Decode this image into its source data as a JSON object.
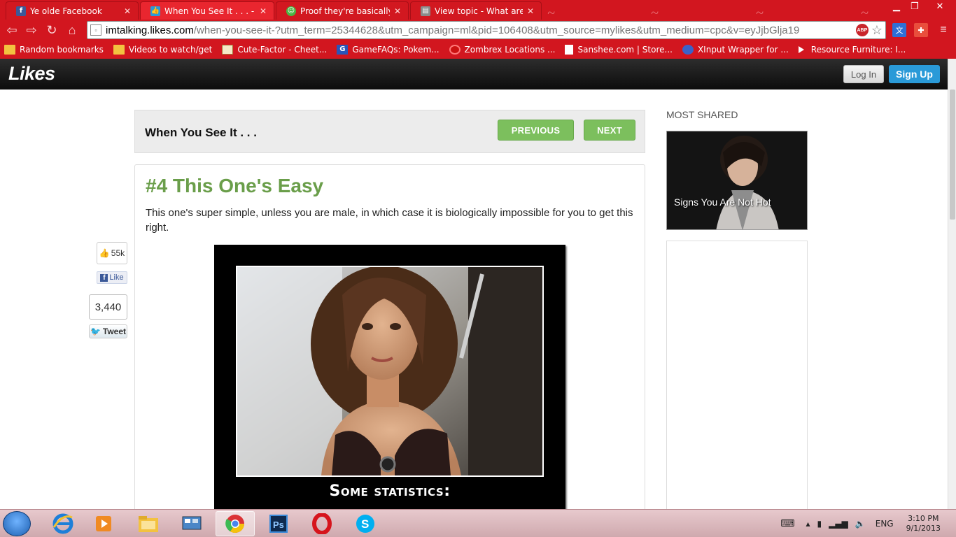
{
  "browser": {
    "tabs": [
      {
        "label": "Ye olde Facebook",
        "icon": "facebook-icon",
        "color": "#3b5998"
      },
      {
        "label": "When You See It . . . - Like",
        "icon": "likes-thumb-icon",
        "color": "#2a9ad8"
      },
      {
        "label": "Proof they're basically the",
        "icon": "smiley-icon",
        "color": "#4bb543"
      },
      {
        "label": "View topic - What are you",
        "icon": "forum-icon",
        "color": "#777"
      }
    ],
    "url_host": "imtalking.likes.com",
    "url_path": "/when-you-see-it-?utm_term=25344628&utm_campaign=ml&pid=106408&utm_source=mylikes&utm_medium=cpc&v=eyJjbGlja19",
    "abp_label": "ABP",
    "bookmarks": [
      {
        "label": "Random bookmarks",
        "icon": "folder-icon"
      },
      {
        "label": "Videos to watch/get",
        "icon": "folder-icon"
      },
      {
        "label": "Cute-Factor - Cheet...",
        "icon": "cheetah-icon"
      },
      {
        "label": "GameFAQs: Pokem...",
        "icon": "gamefaqs-icon"
      },
      {
        "label": "Zombrex Locations ...",
        "icon": "zombrex-icon"
      },
      {
        "label": "Sanshee.com | Store...",
        "icon": "page-icon"
      },
      {
        "label": "XInput Wrapper for ...",
        "icon": "xinput-icon"
      },
      {
        "label": "Resource Furniture: I...",
        "icon": "youtube-icon"
      }
    ]
  },
  "site": {
    "logo": "Likes",
    "login_label": "Log In",
    "signup_label": "Sign Up",
    "accent": "#2a9ad8"
  },
  "article": {
    "header_title": "When You See It . . .",
    "previous_label": "PREVIOUS",
    "next_label": "NEXT",
    "heading": "#4 This One's Easy",
    "description": "This one's super simple, unless you are male, in which case it is biologically impossible for you to get this right.",
    "image_caption": "Some statistics:",
    "heading_color": "#6a9e4a",
    "button_color": "#7cbf5d"
  },
  "share": {
    "fb_count": "55k",
    "fb_like_label": "Like",
    "tweet_count": "3,440",
    "tweet_label": "Tweet"
  },
  "sidebar": {
    "most_shared_label": "MOST SHARED",
    "shared_item_title": "Signs You Are Not Hot"
  },
  "taskbar": {
    "apps": [
      "internet-explorer-icon",
      "media-player-icon",
      "file-explorer-icon",
      "control-panel-icon",
      "chrome-icon",
      "photoshop-icon",
      "opera-icon",
      "skype-icon"
    ],
    "language": "ENG",
    "time": "3:10 PM",
    "date": "9/1/2013"
  }
}
